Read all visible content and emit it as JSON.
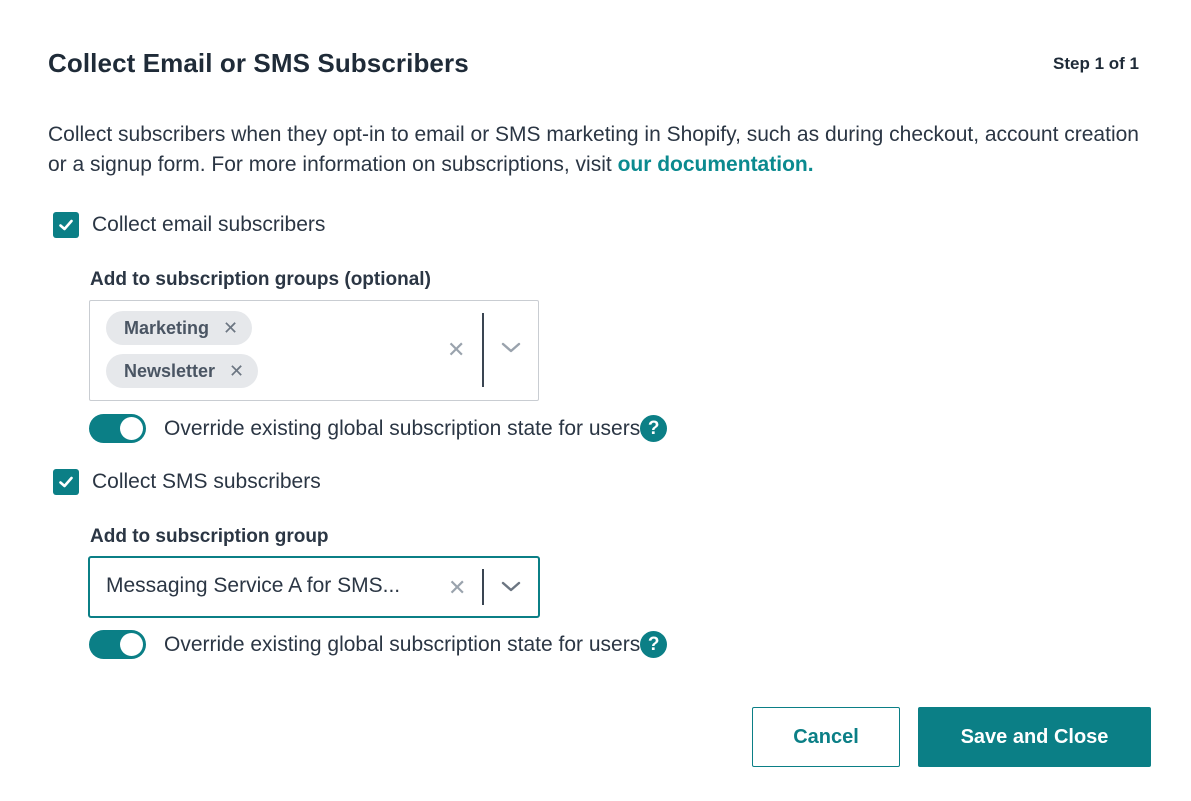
{
  "dialog": {
    "title": "Collect Email or SMS Subscribers",
    "step": "Step 1 of 1",
    "description": "Collect subscribers when they opt-in to email or SMS marketing in Shopify, such as during checkout, account creation or a signup form. For more information on subscriptions, visit ",
    "doc_link": "our documentation."
  },
  "email": {
    "checkbox_label": "Collect email subscribers",
    "checked": true,
    "groups_label": "Add to subscription groups (optional)",
    "tags": [
      {
        "label": "Marketing",
        "remove": "✕"
      },
      {
        "label": "Newsletter",
        "remove": "✕"
      }
    ],
    "clear": "✕",
    "toggle_label": "Override existing global subscription state for users",
    "toggle_on": true,
    "help": "?"
  },
  "sms": {
    "checkbox_label": "Collect SMS subscribers",
    "checked": true,
    "group_label": "Add to subscription group",
    "selected_value": "Messaging Service A for SMS...",
    "clear": "✕",
    "toggle_label": "Override existing global subscription state for users",
    "toggle_on": true,
    "help": "?"
  },
  "footer": {
    "cancel": "Cancel",
    "save": "Save and Close"
  },
  "colors": {
    "accent": "#0b7f86",
    "link": "#0b8a8f",
    "tag_bg": "#e6e8eb",
    "text": "#1f2b38"
  },
  "icons": {
    "checkbox": "check-icon",
    "tag_remove": "close-icon",
    "dropdown": "chevron-down-icon",
    "help": "question-circle-icon"
  }
}
